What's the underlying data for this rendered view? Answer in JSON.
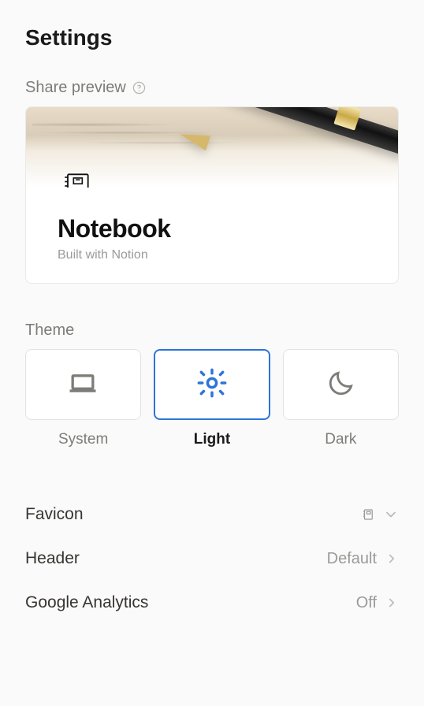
{
  "page": {
    "title": "Settings"
  },
  "share_preview": {
    "label": "Share preview",
    "title": "Notebook",
    "subtitle": "Built with Notion"
  },
  "theme": {
    "label": "Theme",
    "options": [
      {
        "id": "system",
        "label": "System",
        "selected": false
      },
      {
        "id": "light",
        "label": "Light",
        "selected": true
      },
      {
        "id": "dark",
        "label": "Dark",
        "selected": false
      }
    ]
  },
  "settings": [
    {
      "name": "Favicon",
      "value": "",
      "value_icon": "notebook-mini-icon"
    },
    {
      "name": "Header",
      "value": "Default"
    },
    {
      "name": "Google Analytics",
      "value": "Off"
    }
  ]
}
